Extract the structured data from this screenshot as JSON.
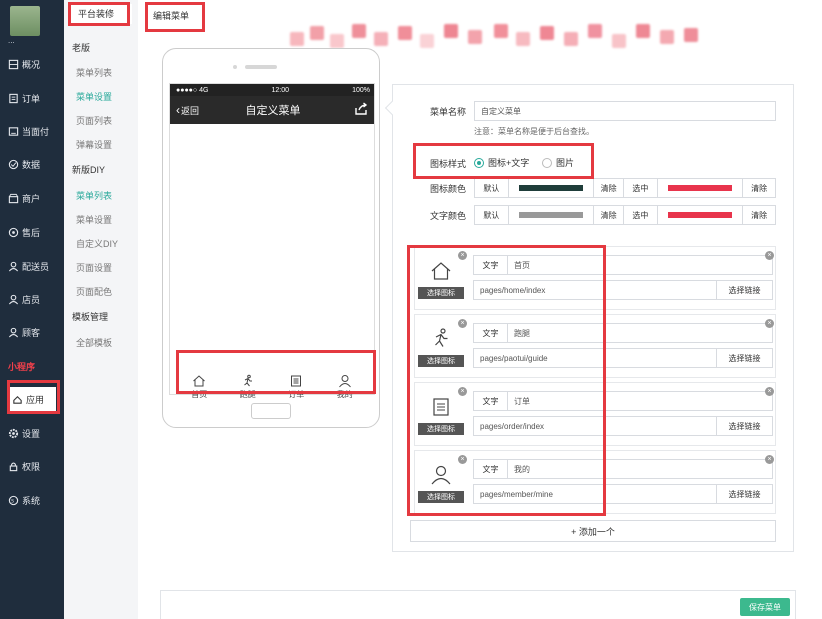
{
  "nav": {
    "username": "...",
    "items": [
      {
        "label": "概况",
        "icon": "overview-icon"
      },
      {
        "label": "订单",
        "icon": "order-icon"
      },
      {
        "label": "当面付",
        "icon": "pay-icon"
      },
      {
        "label": "数据",
        "icon": "data-icon"
      },
      {
        "label": "商户",
        "icon": "shop-icon"
      },
      {
        "label": "售后",
        "icon": "aftersale-icon"
      },
      {
        "label": "配送员",
        "icon": "courier-icon"
      },
      {
        "label": "店员",
        "icon": "clerk-icon"
      },
      {
        "label": "顾客",
        "icon": "customer-icon"
      }
    ],
    "section": "小程序",
    "apps": "应用",
    "settings": "设置",
    "permissions": "权限",
    "system": "系统"
  },
  "subnav": {
    "header": "平台装修",
    "old_group": "老版",
    "old_links": [
      "菜单列表",
      "菜单设置",
      "页面列表",
      "弹幕设置"
    ],
    "diy_group": "新版DIY",
    "diy_links": [
      "菜单列表",
      "菜单设置",
      "自定义DIY",
      "页面设置",
      "页面配色"
    ],
    "tpl_group": "模板管理",
    "tpl_links": [
      "全部模板"
    ]
  },
  "tab": {
    "label": "编辑菜单"
  },
  "phone": {
    "carrier": "●●●●○ 4G",
    "time": "12:00",
    "battery": "100%",
    "back": "返回",
    "title": "自定义菜单",
    "tabs": [
      "首页",
      "跑腿",
      "订单",
      "我的"
    ]
  },
  "form": {
    "name_label": "菜单名称",
    "name_value": "自定义菜单",
    "note": "注意：菜单名称是便于后台查找。",
    "style_label": "图标样式",
    "style_options": [
      "图标+文字",
      "图片"
    ],
    "icon_color_label": "图标颜色",
    "text_color_label": "文字颜色",
    "default": "默认",
    "clear": "清除",
    "selected": "选中",
    "colors": {
      "icon_default": "#1f3d3a",
      "icon_selected": "#e8344c",
      "text_default": "#999999",
      "text_selected": "#e8344c"
    }
  },
  "menu_items": [
    {
      "key": "文字",
      "text": "首页",
      "path": "pages/home/index",
      "icon": "home-icon"
    },
    {
      "key": "文字",
      "text": "跑腿",
      "path": "pages/paotui/guide",
      "icon": "runner-icon"
    },
    {
      "key": "文字",
      "text": "订单",
      "path": "pages/order/index",
      "icon": "order-list-icon"
    },
    {
      "key": "文字",
      "text": "我的",
      "path": "pages/member/mine",
      "icon": "user-icon"
    }
  ],
  "menu_item_ui": {
    "select_icon": "选择图标",
    "select_link": "选择链接"
  },
  "add_label": "+ 添加一个",
  "save_label": "保存菜单"
}
